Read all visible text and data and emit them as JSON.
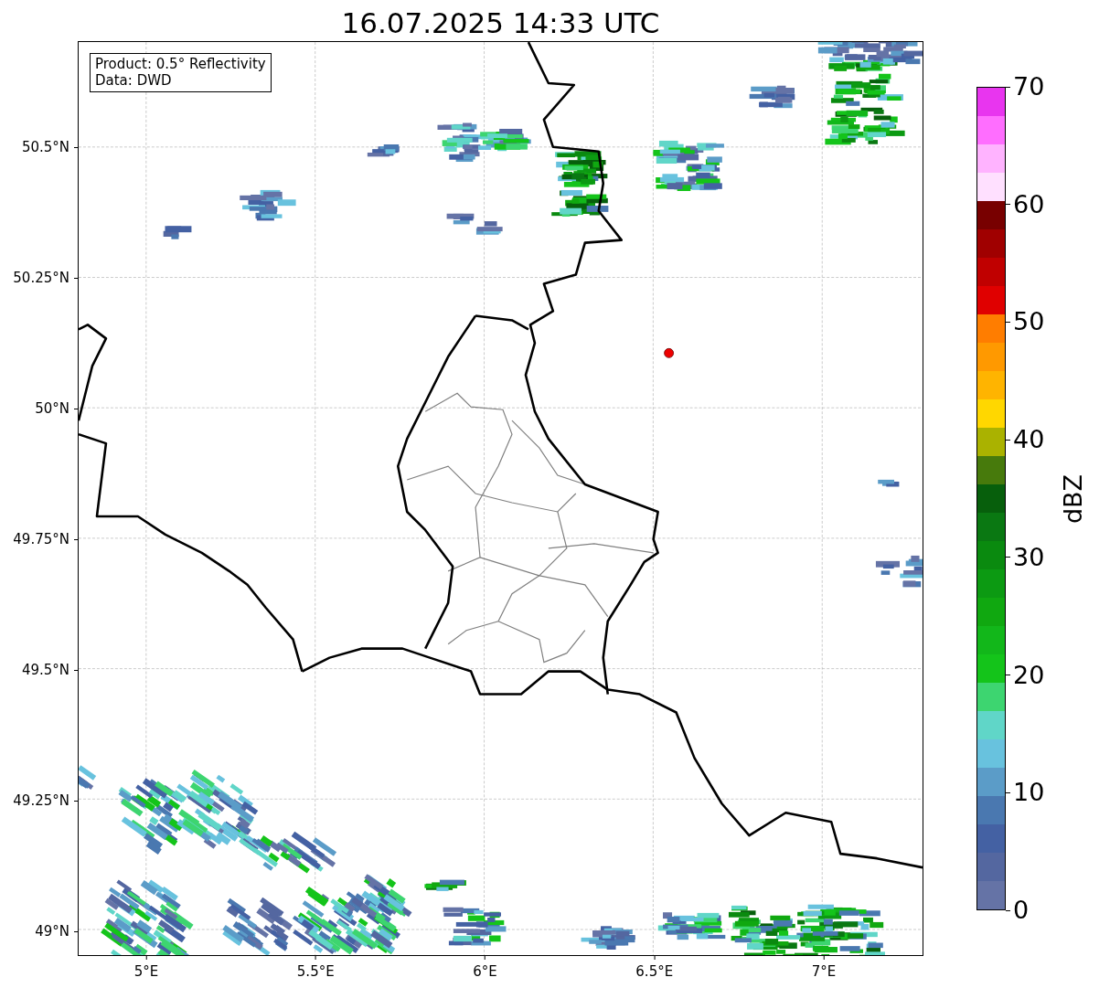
{
  "title": "16.07.2025 14:33 UTC",
  "legend": {
    "lines": [
      "Product: 0.5° Reflectivity",
      "Data: DWD"
    ]
  },
  "map": {
    "x_ticks": [
      "5°E",
      "5.5°E",
      "6°E",
      "6.5°E",
      "7°E"
    ],
    "y_ticks": [
      "50.5°N",
      "50.25°N",
      "50°N",
      "49.75°N",
      "49.5°N",
      "49.25°N",
      "49°N"
    ]
  },
  "colorbar": {
    "label": "dBZ",
    "ticks": [
      "70",
      "60",
      "50",
      "40",
      "30",
      "20",
      "10",
      "0"
    ],
    "bins": [
      {
        "color": "#e835ef"
      },
      {
        "color": "#ff6eff"
      },
      {
        "color": "#ffb3ff"
      },
      {
        "color": "#ffe0ff"
      },
      {
        "color": "#780000"
      },
      {
        "color": "#a00000"
      },
      {
        "color": "#c00000"
      },
      {
        "color": "#e00000"
      },
      {
        "color": "#ff7d00"
      },
      {
        "color": "#ff9900"
      },
      {
        "color": "#ffb400"
      },
      {
        "color": "#ffd700"
      },
      {
        "color": "#aab200"
      },
      {
        "color": "#477a0c"
      },
      {
        "color": "#075f0c"
      },
      {
        "color": "#0a7812"
      },
      {
        "color": "#0a8a0f"
      },
      {
        "color": "#0c9a12"
      },
      {
        "color": "#10a810"
      },
      {
        "color": "#12b71a"
      },
      {
        "color": "#14c41a"
      },
      {
        "color": "#3dd570"
      },
      {
        "color": "#60d6c8"
      },
      {
        "color": "#68c2de"
      },
      {
        "color": "#5b9cc8"
      },
      {
        "color": "#4a78b0"
      },
      {
        "color": "#4461a3"
      },
      {
        "color": "#5467a0"
      },
      {
        "color": "#6573a6"
      }
    ]
  }
}
